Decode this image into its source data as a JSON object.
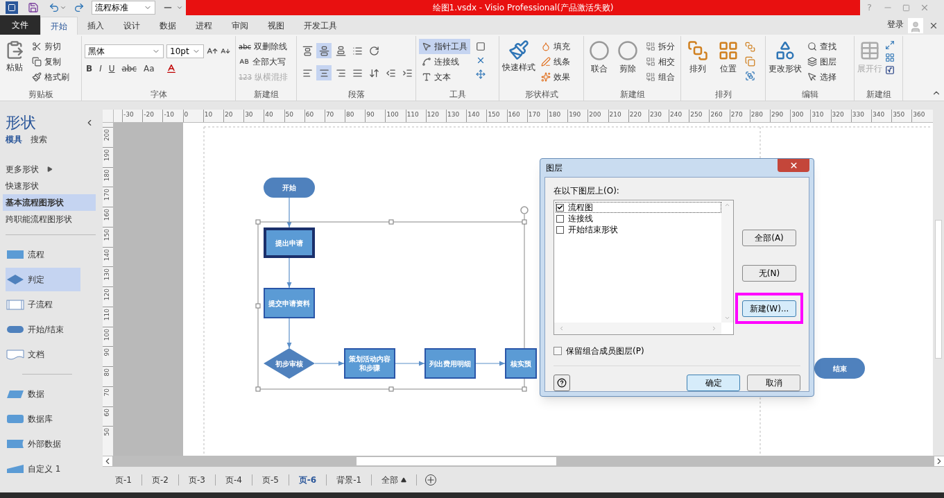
{
  "title_bar": {
    "style_combo": "流程标准",
    "title": "绘图1.vsdx - Visio Professional(产品激活失败)",
    "help": "?"
  },
  "ribbon_tabs": [
    {
      "label": "文件",
      "kind": "file",
      "selected": false
    },
    {
      "label": "开始",
      "kind": "tab",
      "selected": true
    },
    {
      "label": "插入",
      "kind": "tab",
      "selected": false
    },
    {
      "label": "设计",
      "kind": "tab",
      "selected": false
    },
    {
      "label": "数据",
      "kind": "tab",
      "selected": false
    },
    {
      "label": "进程",
      "kind": "tab",
      "selected": false
    },
    {
      "label": "审阅",
      "kind": "tab",
      "selected": false
    },
    {
      "label": "视图",
      "kind": "tab",
      "selected": false
    },
    {
      "label": "开发工具",
      "kind": "tab",
      "selected": false
    }
  ],
  "account": {
    "label": "登录"
  },
  "ribbon": {
    "clipboard": {
      "label": "剪贴板",
      "paste": "粘贴",
      "items": [
        "剪切",
        "复制",
        "格式刷"
      ]
    },
    "font": {
      "label": "字体",
      "font_name": "黑体",
      "font_size": "10pt",
      "styles": [
        "B",
        "I",
        "U",
        "abc",
        "Aa"
      ]
    },
    "text_group": {
      "label": "新建组",
      "items": [
        {
          "label": "双删除线",
          "prefix": "abc",
          "disabled": false
        },
        {
          "label": "全部大写",
          "disabled": false
        },
        {
          "label": "纵横混排",
          "prefix": "123",
          "disabled": true
        }
      ]
    },
    "paragraph": {
      "label": "段落",
      "rows": [
        [
          {
            "kind": "top",
            "selected": false
          },
          {
            "kind": "middle",
            "selected": true
          },
          {
            "kind": "bottom",
            "selected": false
          },
          {
            "kind": "bullets",
            "selected": false
          },
          {
            "kind": "rotate",
            "selected": false
          }
        ],
        [
          {
            "kind": "left",
            "selected": false
          },
          {
            "kind": "center",
            "selected": true
          },
          {
            "kind": "right",
            "selected": false
          },
          {
            "kind": "justify",
            "selected": false
          },
          {
            "kind": "spacing",
            "selected": false
          },
          {
            "kind": "outdent",
            "selected": false
          },
          {
            "kind": "indent",
            "selected": false
          }
        ]
      ]
    },
    "tools": {
      "label": "工具",
      "items": [
        {
          "label": "指针工具",
          "kind": "pointer",
          "selected": true
        },
        {
          "label": "连接线",
          "kind": "connector",
          "selected": false
        },
        {
          "label": "文本",
          "kind": "text",
          "selected": false
        }
      ]
    },
    "shape_styles": {
      "label": "形状样式",
      "quick_styles": "快速样式",
      "items": [
        "填充",
        "线条",
        "效果"
      ]
    },
    "operations": {
      "label": "新建组",
      "large": [
        "联合",
        "剪除"
      ],
      "items": [
        "拆分",
        "相交",
        "组合"
      ]
    },
    "arrange": {
      "label": "排列",
      "large": [
        "排列",
        "位置"
      ]
    },
    "editing": {
      "label": "编辑",
      "change_shape": "更改形状",
      "items": [
        "查找",
        "图层",
        "选择"
      ]
    },
    "expand": {
      "label": "新建组",
      "expand_row": "展开行",
      "disabled": true
    }
  },
  "shapes_panel": {
    "title": "形状",
    "tabs": [
      {
        "label": "模具",
        "selected": true
      },
      {
        "label": "搜索",
        "selected": false
      }
    ],
    "nav": [
      {
        "label": "更多形状",
        "kind": "submenu",
        "selected": false
      },
      {
        "label": "快速形状",
        "kind": "item",
        "selected": false
      },
      {
        "label": "基本流程图形状",
        "kind": "item",
        "selected": true
      },
      {
        "label": "跨职能流程图形状",
        "kind": "item",
        "selected": false
      }
    ],
    "stencil_groups": [
      [
        {
          "label": "流程",
          "kind": "process",
          "selected": false
        },
        {
          "label": "判定",
          "kind": "decision",
          "selected": true
        },
        {
          "label": "子流程",
          "kind": "subprocess",
          "selected": false
        },
        {
          "label": "开始/结束",
          "kind": "terminator",
          "selected": false
        },
        {
          "label": "文档",
          "kind": "document",
          "selected": false
        }
      ],
      [
        {
          "label": "数据",
          "kind": "data",
          "selected": false
        },
        {
          "label": "数据库",
          "kind": "database",
          "selected": false
        },
        {
          "label": "外部数据",
          "kind": "external",
          "selected": false
        },
        {
          "label": "自定义 1",
          "kind": "custom",
          "selected": false
        }
      ]
    ]
  },
  "rulers": {
    "horizontal": [
      "-30",
      "-20",
      "-10",
      "0",
      "10",
      "20",
      "30",
      "40",
      "50",
      "60",
      "70",
      "80",
      "90",
      "100",
      "110",
      "120",
      "130",
      "140",
      "150",
      "160",
      "170",
      "180",
      "190",
      "200",
      "210",
      "220",
      "230",
      "240",
      "250",
      "260",
      "270",
      "280",
      "290",
      "300",
      "310",
      "320",
      "330",
      "340",
      "350",
      "360"
    ],
    "vertical": [
      "200",
      "190",
      "180",
      "170",
      "160",
      "150",
      "140",
      "130",
      "120",
      "110",
      "100",
      "90",
      "80",
      "70",
      "60",
      "50"
    ]
  },
  "diagram": {
    "nodes": [
      {
        "kind": "terminator",
        "text": "开始",
        "emphasized": false
      },
      {
        "kind": "process",
        "text": "提出申请",
        "emphasized": true
      },
      {
        "kind": "process",
        "text": "提交申请资料",
        "emphasized": false
      },
      {
        "kind": "decision",
        "text": "初步审核",
        "emphasized": false
      },
      {
        "kind": "process",
        "text": "策划活动内容和步骤",
        "emphasized": false
      },
      {
        "kind": "process",
        "text": "列出费用明细",
        "emphasized": false
      },
      {
        "kind": "process",
        "text": "核实预",
        "emphasized": false
      },
      {
        "kind": "terminator",
        "text": "结束",
        "emphasized": false
      }
    ]
  },
  "dialog": {
    "title": "图层",
    "list_label": "在以下图层上(O):",
    "layers": [
      {
        "name": "流程图",
        "checked": true,
        "selected": true
      },
      {
        "name": "连接线",
        "checked": false,
        "selected": false
      },
      {
        "name": "开始结束形状",
        "checked": false,
        "selected": false
      }
    ],
    "side_buttons": [
      {
        "label": "全部(A)",
        "highlighted": false
      },
      {
        "label": "无(N)",
        "highlighted": false
      },
      {
        "label": "新建(W)...",
        "highlighted": true
      }
    ],
    "keep_group": {
      "label": "保留组合成员图层(P)",
      "checked": false
    },
    "ok": "确定",
    "cancel": "取消"
  },
  "page_tabs": [
    {
      "label": "页-1",
      "kind": "page",
      "selected": false
    },
    {
      "label": "页-2",
      "kind": "page",
      "selected": false
    },
    {
      "label": "页-3",
      "kind": "page",
      "selected": false
    },
    {
      "label": "页-4",
      "kind": "page",
      "selected": false
    },
    {
      "label": "页-5",
      "kind": "page",
      "selected": false
    },
    {
      "label": "页-6",
      "kind": "page",
      "selected": true
    },
    {
      "label": "背景-1",
      "kind": "page",
      "selected": false
    },
    {
      "label": "全部",
      "kind": "all",
      "selected": false
    }
  ]
}
